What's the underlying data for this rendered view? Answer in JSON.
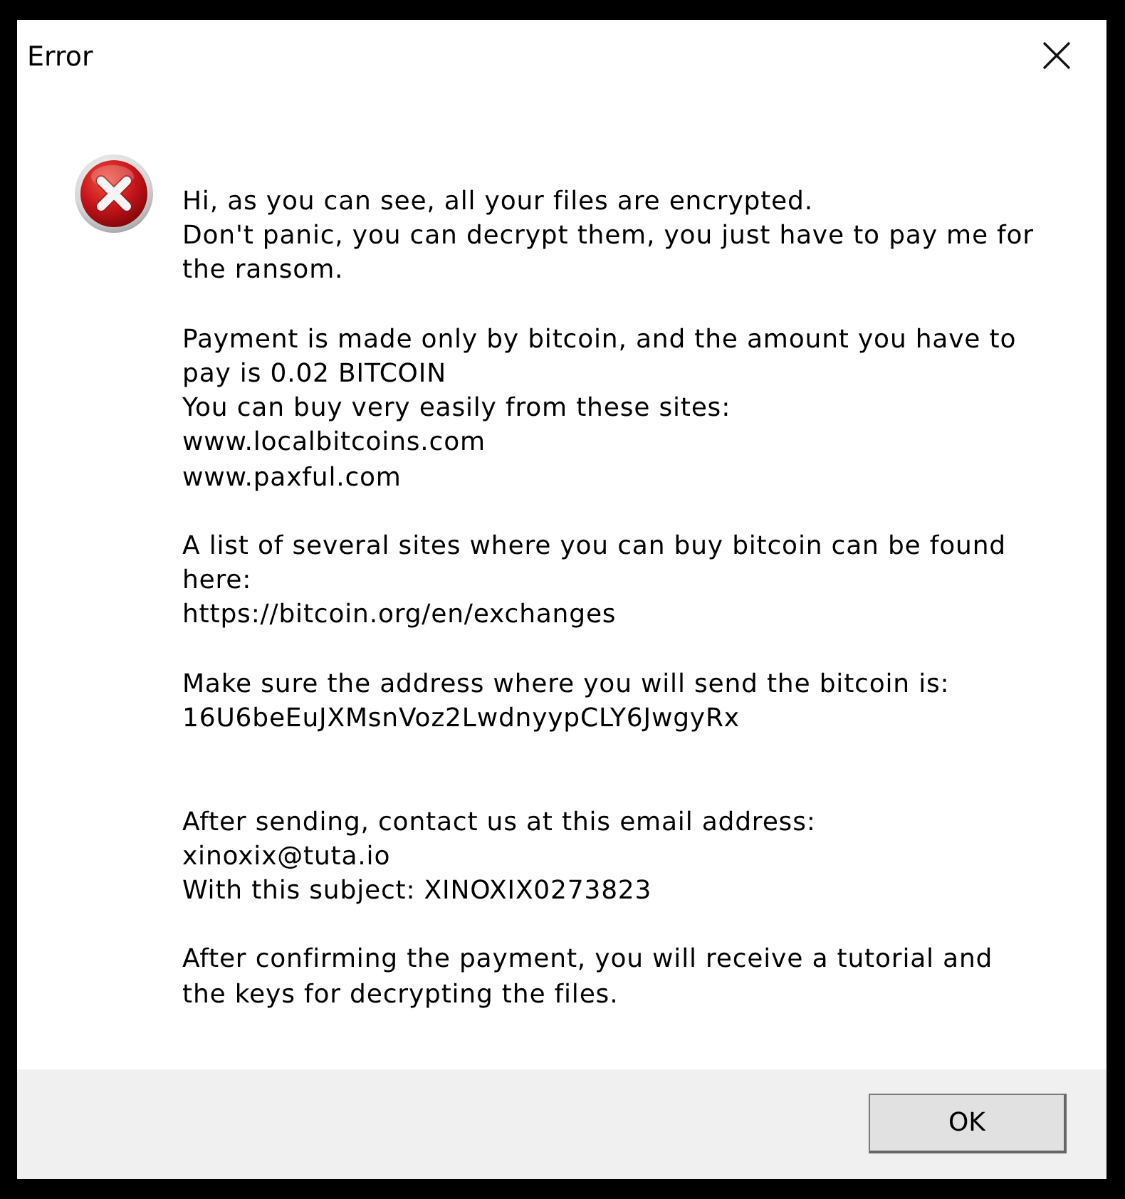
{
  "window": {
    "title": "Error"
  },
  "message": "Hi, as you can see, all your files are encrypted.\nDon't panic, you can decrypt them, you just have to pay me for\nthe ransom.\n\nPayment is made only by bitcoin, and the amount you have to\npay is 0.02 BITCOIN\nYou can buy very easily from these sites:\nwww.localbitcoins.com\nwww.paxful.com\n\nA list of several sites where you can buy bitcoin can be found\nhere:\nhttps://bitcoin.org/en/exchanges\n\nMake sure the address where you will send the bitcoin is:\n16U6beEuJXMsnVoz2LwdnyypCLY6JwgyRx\n\n\nAfter sending, contact us at this email address:\nxinoxix@tuta.io\nWith this subject: XINOXIX0273823\n\nAfter confirming the payment, you will receive a tutorial and\nthe keys for decrypting the files.",
  "buttons": [
    {
      "label": "OK"
    }
  ]
}
